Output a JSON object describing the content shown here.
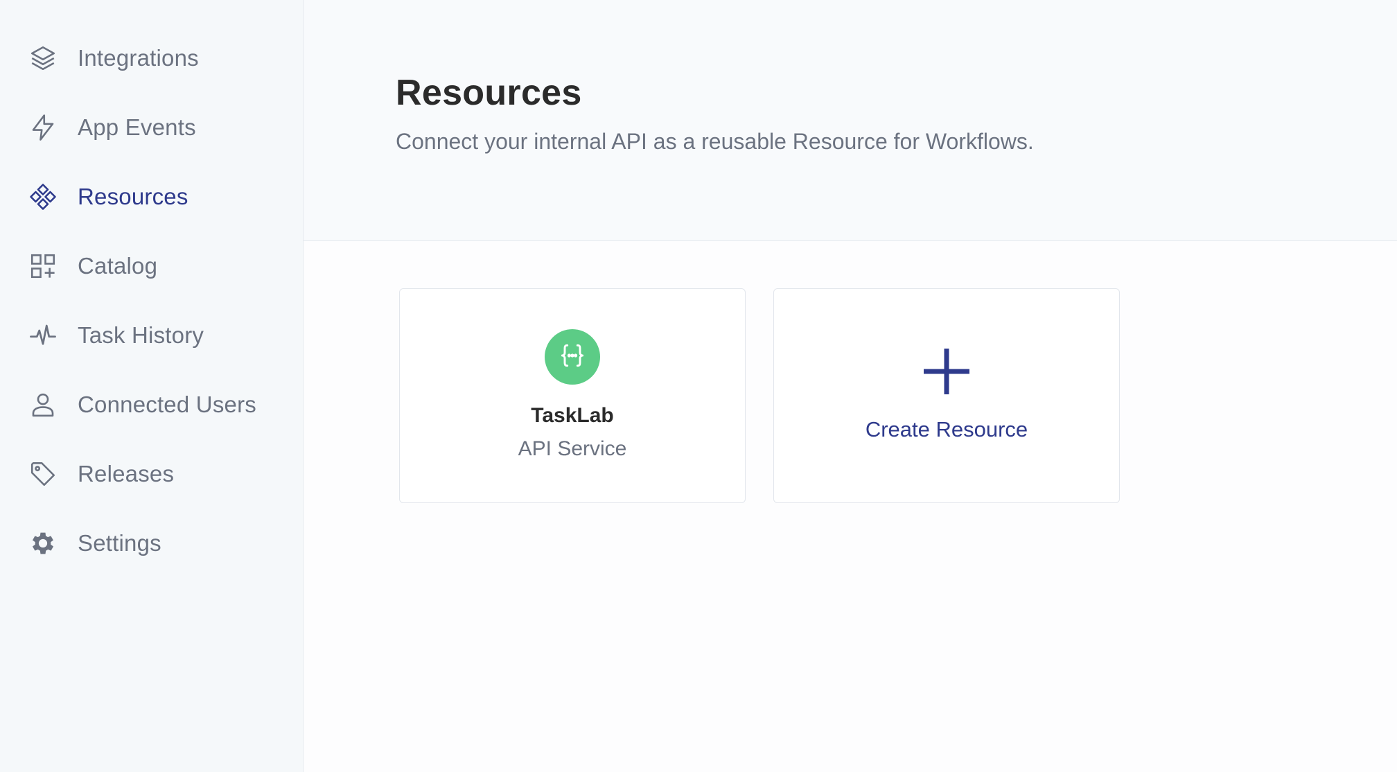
{
  "sidebar": {
    "items": [
      {
        "label": "Integrations",
        "icon": "layers-icon"
      },
      {
        "label": "App Events",
        "icon": "lightning-icon"
      },
      {
        "label": "Resources",
        "icon": "resources-icon",
        "active": true
      },
      {
        "label": "Catalog",
        "icon": "catalog-icon"
      },
      {
        "label": "Task History",
        "icon": "activity-icon"
      },
      {
        "label": "Connected Users",
        "icon": "user-icon"
      },
      {
        "label": "Releases",
        "icon": "tag-icon"
      },
      {
        "label": "Settings",
        "icon": "gear-icon"
      }
    ]
  },
  "header": {
    "title": "Resources",
    "subtitle": "Connect your internal API as a reusable Resource for Workflows."
  },
  "resources": [
    {
      "name": "TaskLab",
      "type": "API Service",
      "icon": "api-braces-icon",
      "badge_color": "#5ccc86"
    }
  ],
  "create_card": {
    "label": "Create Resource",
    "icon": "plus-icon"
  },
  "colors": {
    "accent": "#2e3a8c",
    "muted_text": "#6b7280",
    "badge_green": "#5ccc86"
  }
}
